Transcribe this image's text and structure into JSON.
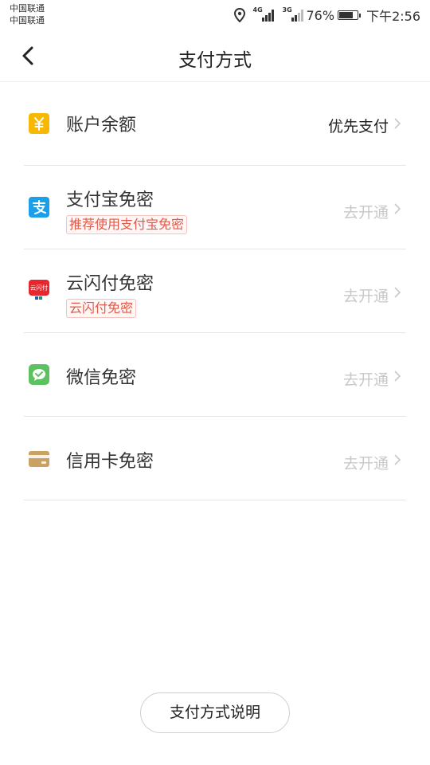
{
  "status_bar": {
    "carrier_1": "中国联通",
    "carrier_2": "中国联通",
    "network_1": "4G",
    "network_2": "3G",
    "battery": "76%",
    "time": "下午2:56"
  },
  "header": {
    "title": "支付方式"
  },
  "payment_methods": [
    {
      "icon": "yuan-icon",
      "title": "账户余额",
      "subtitle": "",
      "action": "优先支付",
      "color": "#f6b800"
    },
    {
      "icon": "alipay-icon",
      "title": "支付宝免密",
      "subtitle": "推荐使用支付宝免密",
      "action": "去开通",
      "color": "#1a9fe8"
    },
    {
      "icon": "unionpay-cloud-icon",
      "title": "云闪付免密",
      "subtitle": "云闪付免密",
      "action": "去开通",
      "color": "#e8262d"
    },
    {
      "icon": "wechat-icon",
      "title": "微信免密",
      "subtitle": "",
      "action": "去开通",
      "color": "#5cc15f"
    },
    {
      "icon": "credit-card-icon",
      "title": "信用卡免密",
      "subtitle": "",
      "action": "去开通",
      "color": "#c9a263"
    }
  ],
  "footer": {
    "button_label": "支付方式说明"
  }
}
